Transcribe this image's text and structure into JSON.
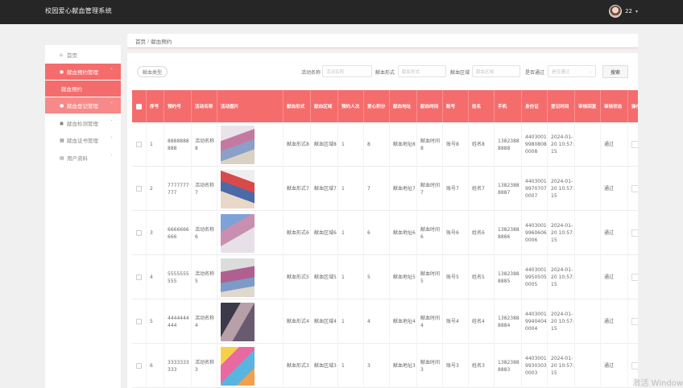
{
  "header": {
    "app_title": "校园爱心献血管理系统",
    "username": "22",
    "caret": "▾"
  },
  "sidebar": {
    "items": [
      {
        "label": "首页",
        "icon": "⌂"
      },
      {
        "label": "献血预约管理",
        "icon": "◼",
        "chev": "ˆ"
      },
      {
        "label": "献血预约"
      },
      {
        "label": "献血登记管理",
        "icon": "●",
        "chev": "ˇ"
      },
      {
        "label": "献血检测管理",
        "icon": "◼",
        "chev": "ˇ"
      },
      {
        "label": "献血证书管理",
        "icon": "▦",
        "chev": "ˇ"
      },
      {
        "label": "用户资料",
        "icon": "▤",
        "chev": "ˇ"
      }
    ]
  },
  "breadcrumb": {
    "home": "首页",
    "sep": "/",
    "current": "献血预约"
  },
  "filters": {
    "type_button": "献血类型",
    "activity_label": "活动名称",
    "activity_placeholder": "活动名称",
    "form_label": "献血形式",
    "form_placeholder": "献血形式",
    "area_label": "献血区域",
    "area_placeholder": "献血区域",
    "pass_label": "是否通过",
    "pass_placeholder": "是否通过",
    "dropdown_arrow": "⌄",
    "search_button": "搜索"
  },
  "table": {
    "headers": [
      "",
      "序号",
      "预约号",
      "活动名称",
      "活动图片",
      "献血形式",
      "献血区域",
      "预约人次",
      "爱心积分",
      "献血地址",
      "献血时间",
      "账号",
      "姓名",
      "手机",
      "身份证",
      "登记时间",
      "审核回复",
      "审核状态",
      "操作"
    ],
    "rows": [
      {
        "index": "1",
        "booking_no": "8888888888",
        "activity": "活动名称8",
        "form": "献血形式8",
        "area": "献血区域8",
        "count": "1",
        "points": "8",
        "address": "献血地址8",
        "time": "献血时间8",
        "account": "账号8",
        "name": "姓名8",
        "phone": "13823888888",
        "id_card": "440300199808080008",
        "reg_time": "2024-01-20 10:57:15",
        "reply": "",
        "status": "通过"
      },
      {
        "index": "2",
        "booking_no": "7777777777",
        "activity": "活动名称7",
        "form": "献血形式7",
        "area": "献血区域7",
        "count": "1",
        "points": "7",
        "address": "献血地址7",
        "time": "献血时间7",
        "account": "账号7",
        "name": "姓名7",
        "phone": "13823888887",
        "id_card": "440300199707070007",
        "reg_time": "2024-01-20 10:57:15",
        "reply": "",
        "status": "通过"
      },
      {
        "index": "3",
        "booking_no": "6666666666",
        "activity": "活动名称6",
        "form": "献血形式6",
        "area": "献血区域6",
        "count": "1",
        "points": "6",
        "address": "献血地址6",
        "time": "献血时间6",
        "account": "账号6",
        "name": "姓名6",
        "phone": "13823888886",
        "id_card": "440300199606060006",
        "reg_time": "2024-01-20 10:57:15",
        "reply": "",
        "status": "通过"
      },
      {
        "index": "4",
        "booking_no": "5555555555",
        "activity": "活动名称5",
        "form": "献血形式5",
        "area": "献血区域5",
        "count": "1",
        "points": "5",
        "address": "献血地址5",
        "time": "献血时间5",
        "account": "账号5",
        "name": "姓名5",
        "phone": "13823888885",
        "id_card": "440300199505050005",
        "reg_time": "2024-01-20 10:57:15",
        "reply": "",
        "status": "通过"
      },
      {
        "index": "5",
        "booking_no": "4444444444",
        "activity": "活动名称4",
        "form": "献血形式4",
        "area": "献血区域4",
        "count": "1",
        "points": "4",
        "address": "献血地址4",
        "time": "献血时间4",
        "account": "账号4",
        "name": "姓名4",
        "phone": "13823888884",
        "id_card": "440300199404040004",
        "reg_time": "2024-01-20 10:57:15",
        "reply": "",
        "status": "通过"
      },
      {
        "index": "6",
        "booking_no": "3333333333",
        "activity": "活动名称3",
        "form": "献血形式3",
        "area": "献血区域3",
        "count": "1",
        "points": "3",
        "address": "献血地址3",
        "time": "献血时间3",
        "account": "账号3",
        "name": "姓名3",
        "phone": "13823888883",
        "id_card": "440300199303030003",
        "reg_time": "2024-01-20 10:57:15",
        "reply": "",
        "status": "通过"
      }
    ]
  },
  "watermark": "激活 Window",
  "colors": {
    "accent": "#f56c6c",
    "topbar": "#262626"
  }
}
